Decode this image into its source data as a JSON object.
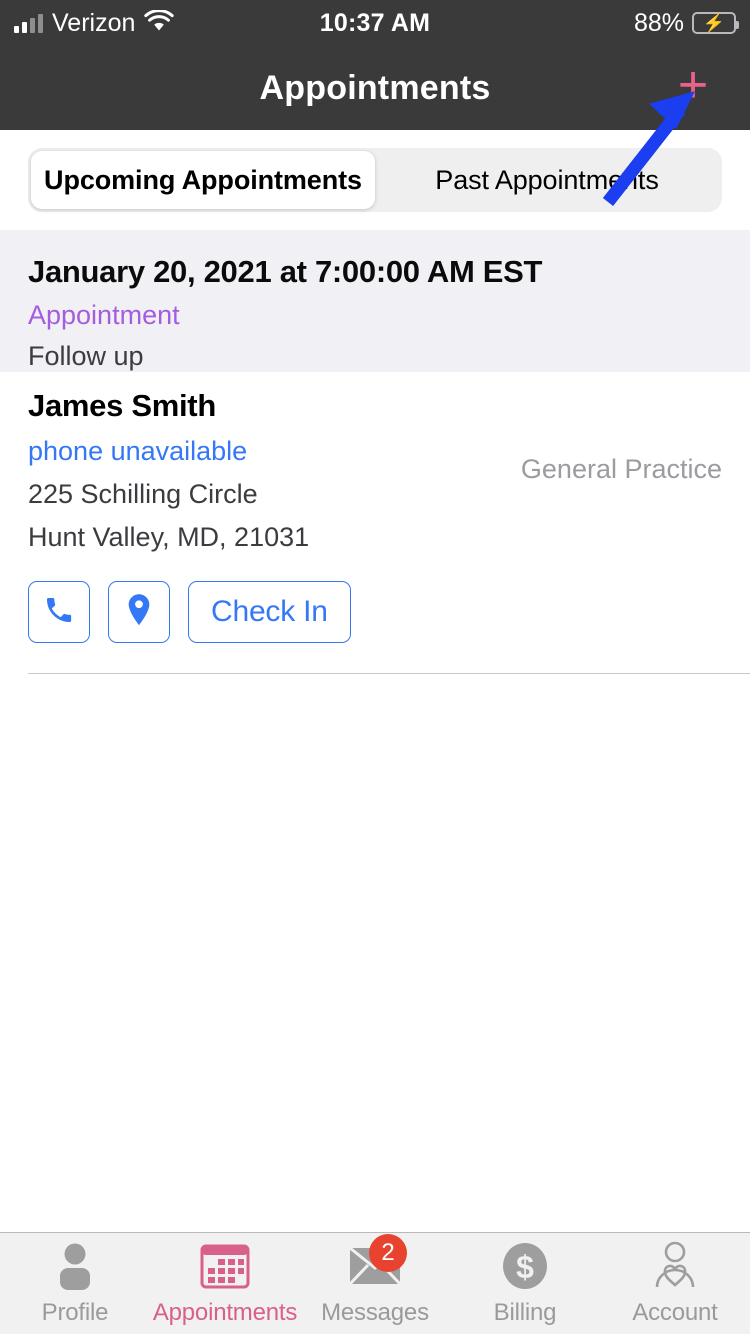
{
  "status_bar": {
    "carrier": "Verizon",
    "signal_bars_filled": 2,
    "signal_bars_total": 4,
    "wifi_icon": "wifi-icon",
    "time": "10:37 AM",
    "battery_percent": "88%",
    "battery_charging": true,
    "battery_color": "#35c759"
  },
  "nav_bar": {
    "title": "Appointments",
    "add_button_label": "+",
    "add_button_color": "#e8628a",
    "background": "#3a3a3a"
  },
  "segmented_control": {
    "selected_index": 0,
    "tabs": [
      {
        "label": "Upcoming Appointments"
      },
      {
        "label": "Past Appointments"
      }
    ]
  },
  "appointment": {
    "datetime": "January 20, 2021 at 7:00:00 AM EST",
    "type": "Appointment",
    "type_color": "#a45de0",
    "reason": "Follow up",
    "provider": {
      "name": "James Smith",
      "phone": "phone unavailable",
      "phone_color": "#3478f6",
      "specialty": "General Practice",
      "address_line1": "225 Schilling Circle",
      "address_line2": "Hunt Valley, MD, 21031"
    },
    "actions": [
      {
        "name": "call-button",
        "icon": "phone-icon",
        "label": ""
      },
      {
        "name": "directions-button",
        "icon": "map-pin-icon",
        "label": ""
      },
      {
        "name": "check-in-button",
        "icon": "",
        "label": "Check In"
      }
    ]
  },
  "tab_bar": {
    "active_index": 1,
    "active_color": "#d9608a",
    "inactive_color": "#9a9a9a",
    "items": [
      {
        "label": "Profile",
        "icon": "person-filled-icon",
        "badge": ""
      },
      {
        "label": "Appointments",
        "icon": "calendar-icon",
        "badge": ""
      },
      {
        "label": "Messages",
        "icon": "envelope-icon",
        "badge": "2"
      },
      {
        "label": "Billing",
        "icon": "dollar-circle-icon",
        "badge": ""
      },
      {
        "label": "Account",
        "icon": "person-heart-icon",
        "badge": ""
      }
    ],
    "badge_color": "#e8432e"
  },
  "annotation": {
    "arrow_color": "#1a3ef0",
    "points_to": "add-appointment-button"
  }
}
